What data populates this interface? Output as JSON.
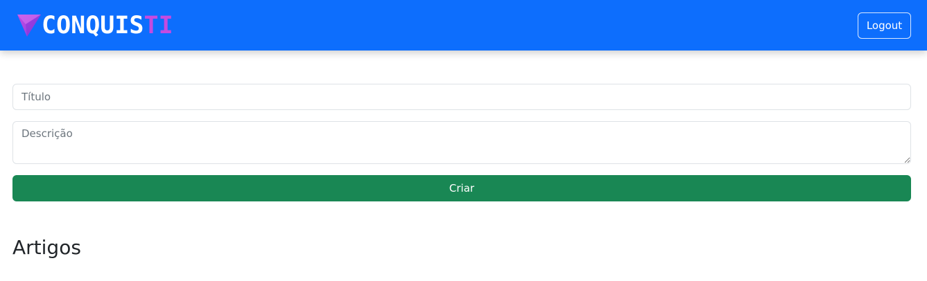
{
  "header": {
    "brand_main": "CONQUIS",
    "brand_accent": "TI",
    "logo_icon": "paper-plane-icon",
    "logout_label": "Logout"
  },
  "form": {
    "title_placeholder": "Título",
    "title_value": "",
    "description_placeholder": "Descrição",
    "description_value": "",
    "submit_label": "Criar"
  },
  "articles": {
    "heading": "Artigos"
  },
  "colors": {
    "navbar": "#0d6efd",
    "brand_accent": "#c44be0",
    "submit_button": "#198754"
  }
}
